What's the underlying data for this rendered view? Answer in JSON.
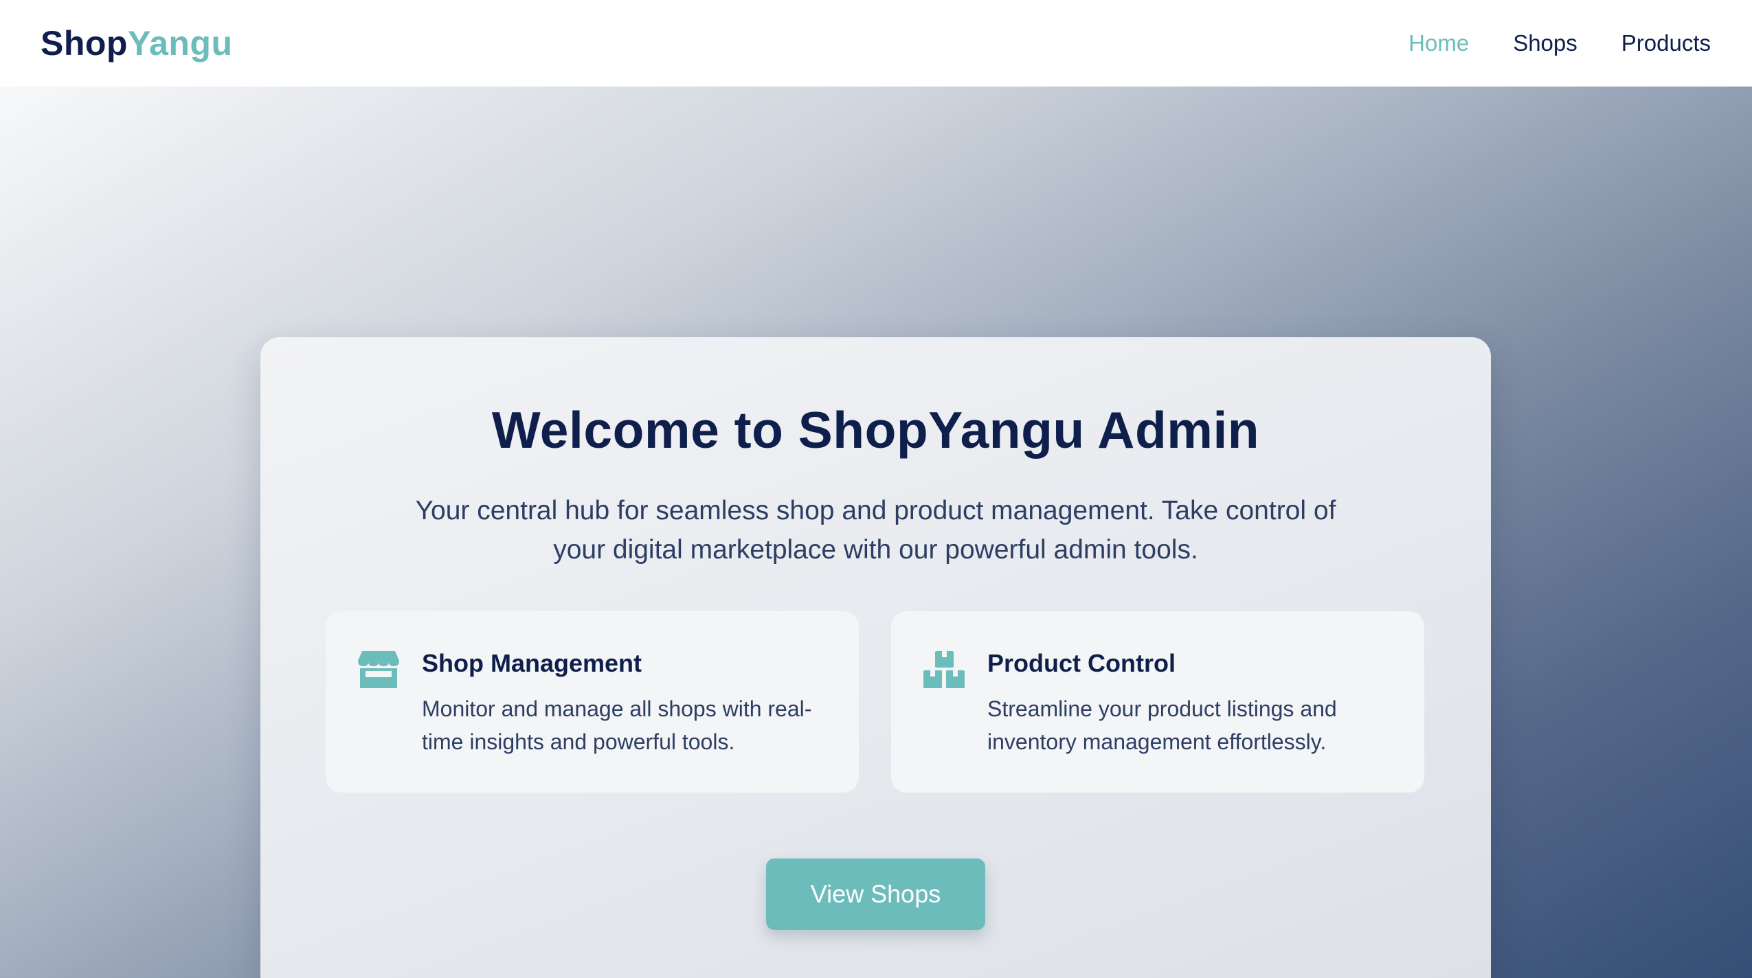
{
  "navbar": {
    "logo_part1": "Shop",
    "logo_part2": "Yangu",
    "links": [
      {
        "label": "Home",
        "active": true
      },
      {
        "label": "Shops",
        "active": false
      },
      {
        "label": "Products",
        "active": false
      }
    ]
  },
  "hero": {
    "title": "Welcome to ShopYangu Admin",
    "subtitle": "Your central hub for seamless shop and product management. Take control of your digital marketplace with our powerful admin tools.",
    "features": [
      {
        "icon": "store-icon",
        "title": "Shop Management",
        "description": "Monitor and manage all shops with real-time insights and powerful tools."
      },
      {
        "icon": "boxes-icon",
        "title": "Product Control",
        "description": "Streamline your product listings and inventory management effortlessly."
      }
    ],
    "cta_label": "View Shops"
  },
  "colors": {
    "brand_navy": "#0f1f4b",
    "accent_teal": "#6cbcbc",
    "body_text": "#2c3e63"
  }
}
